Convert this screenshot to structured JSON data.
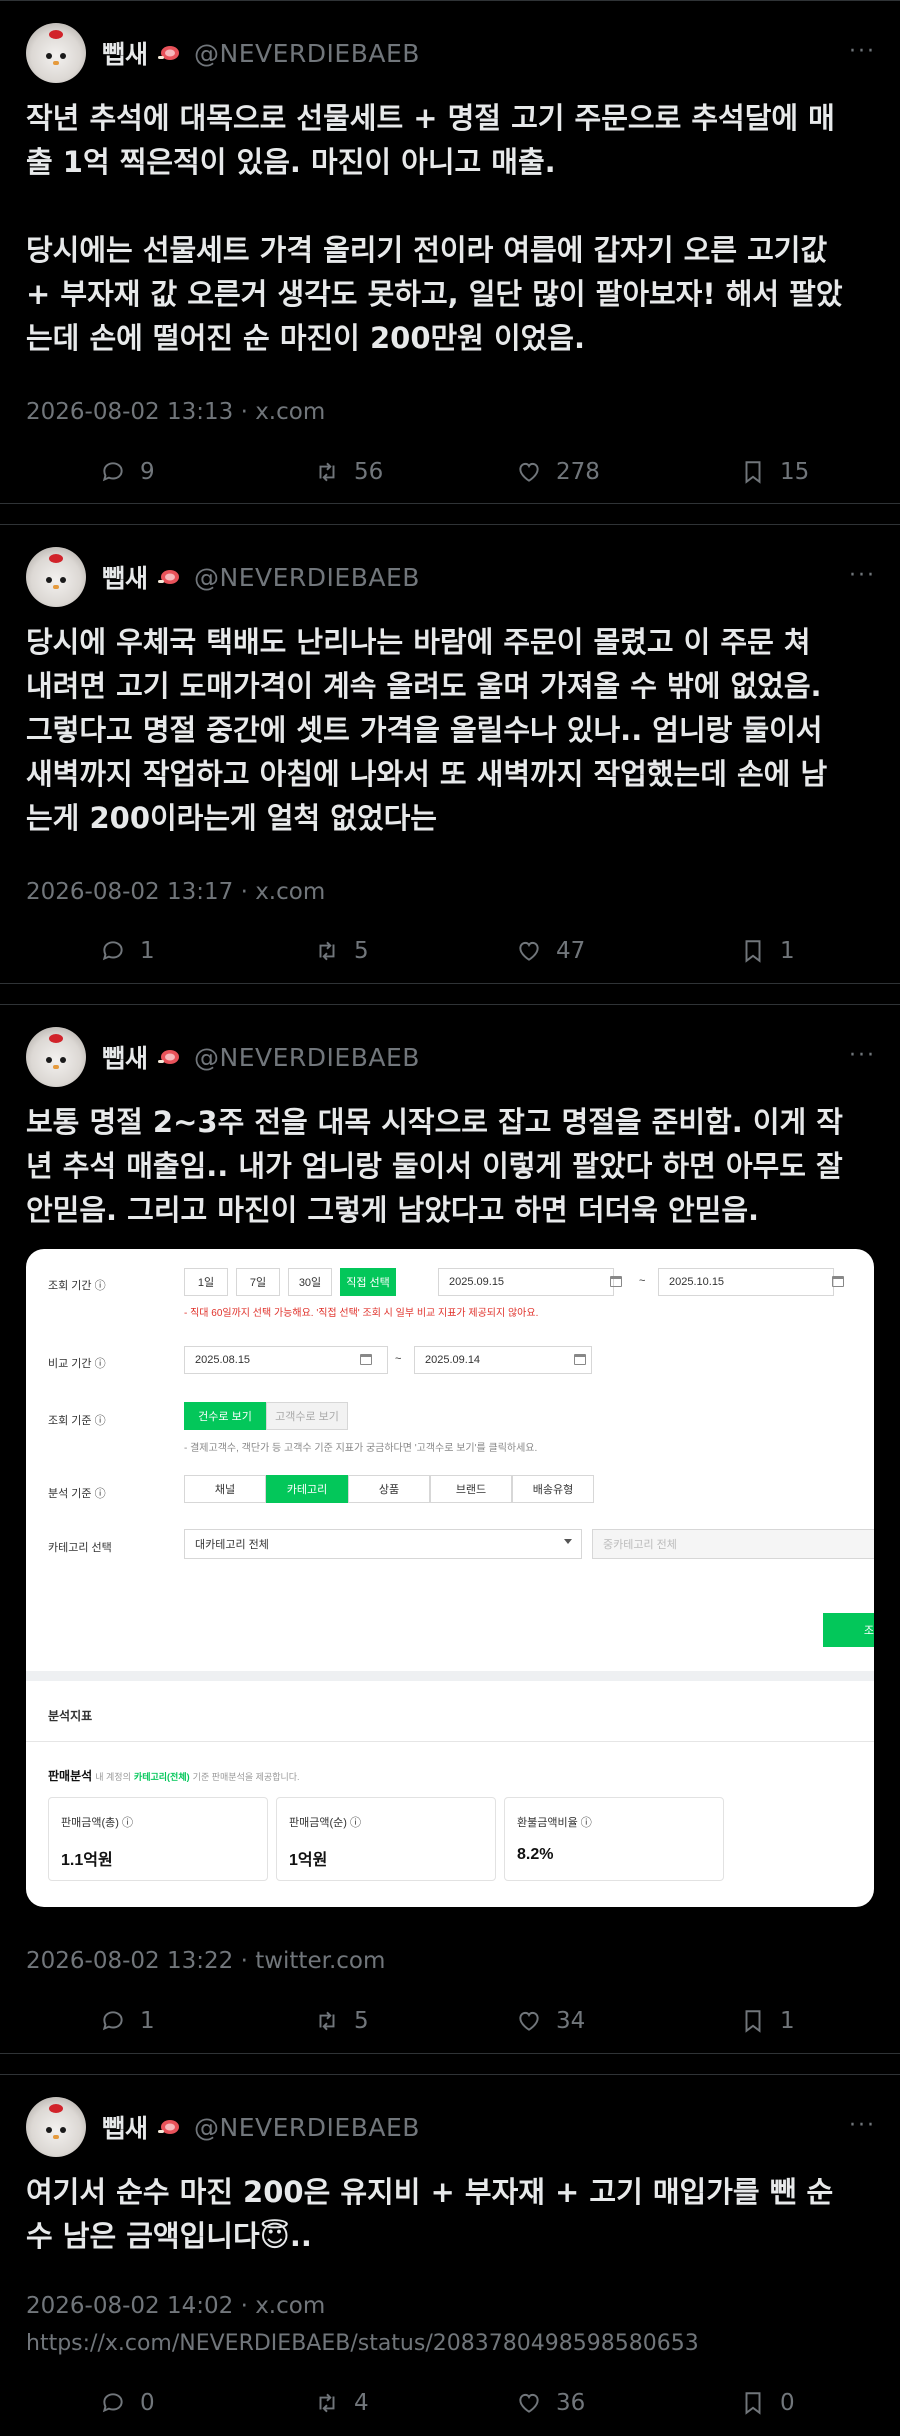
{
  "account": {
    "display_name": "뺍새",
    "handle": "@NEVERDIEBAEB",
    "more_label": "···"
  },
  "tweets": [
    {
      "text": "작년 추석에 대목으로 선물세트 + 명절 고기 주문으로 추석달에 매\n출 1억 찍은적이 있음. 마진이 아니고 매출.\n\n당시에는 선물세트 가격 올리기 전이라 여름에 갑자기 오른 고기값\n+ 부자재 값 오른거 생각도 못하고, 일단 많이 팔아보자! 해서 팔았\n는데 손에 떨어진 순 마진이 200만원 이었음.",
      "meta": "2026-08-02 13:13 · x.com",
      "replies": "9",
      "retweets": "56",
      "likes": "278",
      "bookmarks": "15"
    },
    {
      "text": "당시에 우체국 택배도 난리나는 바람에 주문이 몰렸고 이 주문 쳐\n내려면 고기 도매가격이 계속 올려도 울며 가져올 수 밖에 없었음.\n그렇다고 명절 중간에 셋트 가격을 올릴수나 있나.. 엄니랑 둘이서\n새벽까지 작업하고 아침에 나와서 또 새벽까지 작업했는데 손에 남\n는게 200이라는게 얼척 없었다는",
      "meta": "2026-08-02 13:17 · x.com",
      "replies": "1",
      "retweets": "5",
      "likes": "47",
      "bookmarks": "1"
    },
    {
      "text": "보통 명절 2~3주 전을 대목 시작으로 잡고 명절을 준비함. 이게 작\n년 추석 매출임.. 내가 엄니랑 둘이서 이렇게 팔았다 하면 아무도 잘\n안믿음. 그리고 마진이 그렇게 남았다고 하면 더더욱 안믿음.",
      "meta": "2026-08-02 13:22 · twitter.com",
      "replies": "1",
      "retweets": "5",
      "likes": "34",
      "bookmarks": "1"
    },
    {
      "text": "여기서 순수 마진 200은 유지비 + 부자재 + 고기 매입가를 뺀 순\n수 남은 금액입니다😇..",
      "meta": "2026-08-02 14:02 · x.com",
      "link": "https://x.com/NEVERDIEBAEB/status/2083780498598580653",
      "replies": "0",
      "retweets": "4",
      "likes": "36",
      "bookmarks": "0"
    }
  ],
  "dashboard": {
    "period_label": "조회 기간 ⓘ",
    "period_tabs": [
      "1일",
      "7일",
      "30일",
      "직접 선택"
    ],
    "period_start": "2025.09.15",
    "period_sep": "~",
    "period_end": "2025.10.15",
    "period_note": "- 직대 60일까지 선택 가능해요. '직접 선택' 조회 시 일부 비교 지표가 제공되지 않아요.",
    "compare_label": "비교 기간 ⓘ",
    "compare_start": "2025.08.15",
    "compare_end": "2025.09.14",
    "basis_label": "조회 기준 ⓘ",
    "basis_tabs": [
      "건수로 보기",
      "고객수로 보기"
    ],
    "basis_note": "- 결제고객수, 객단가 등 고객수 기준 지표가 궁금하다면 '고객수로 보기'를 클릭하세요.",
    "analysis_label": "분석 기준 ⓘ",
    "analysis_tabs": [
      "채널",
      "카테고리",
      "상품",
      "브랜드",
      "배송유형"
    ],
    "category_label": "카테고리 선택",
    "category_main": "대카테고리 전체",
    "category_sub": "중카테고리 전체",
    "apply_label": "조",
    "metrics_title": "분석지표",
    "sales_title": "판매분석",
    "sales_desc_pre": "내 계정의",
    "sales_desc_hl": "카테고리(전체)",
    "sales_desc_post": "기준 판매분석을 제공합니다.",
    "cards": [
      {
        "title": "판매금액(총) ⓘ",
        "value": "1.1억원"
      },
      {
        "title": "판매금액(순) ⓘ",
        "value": "1억원"
      },
      {
        "title": "환불금액비율 ⓘ",
        "value": "8.2%"
      }
    ],
    "accent_color": "#03c75a"
  }
}
